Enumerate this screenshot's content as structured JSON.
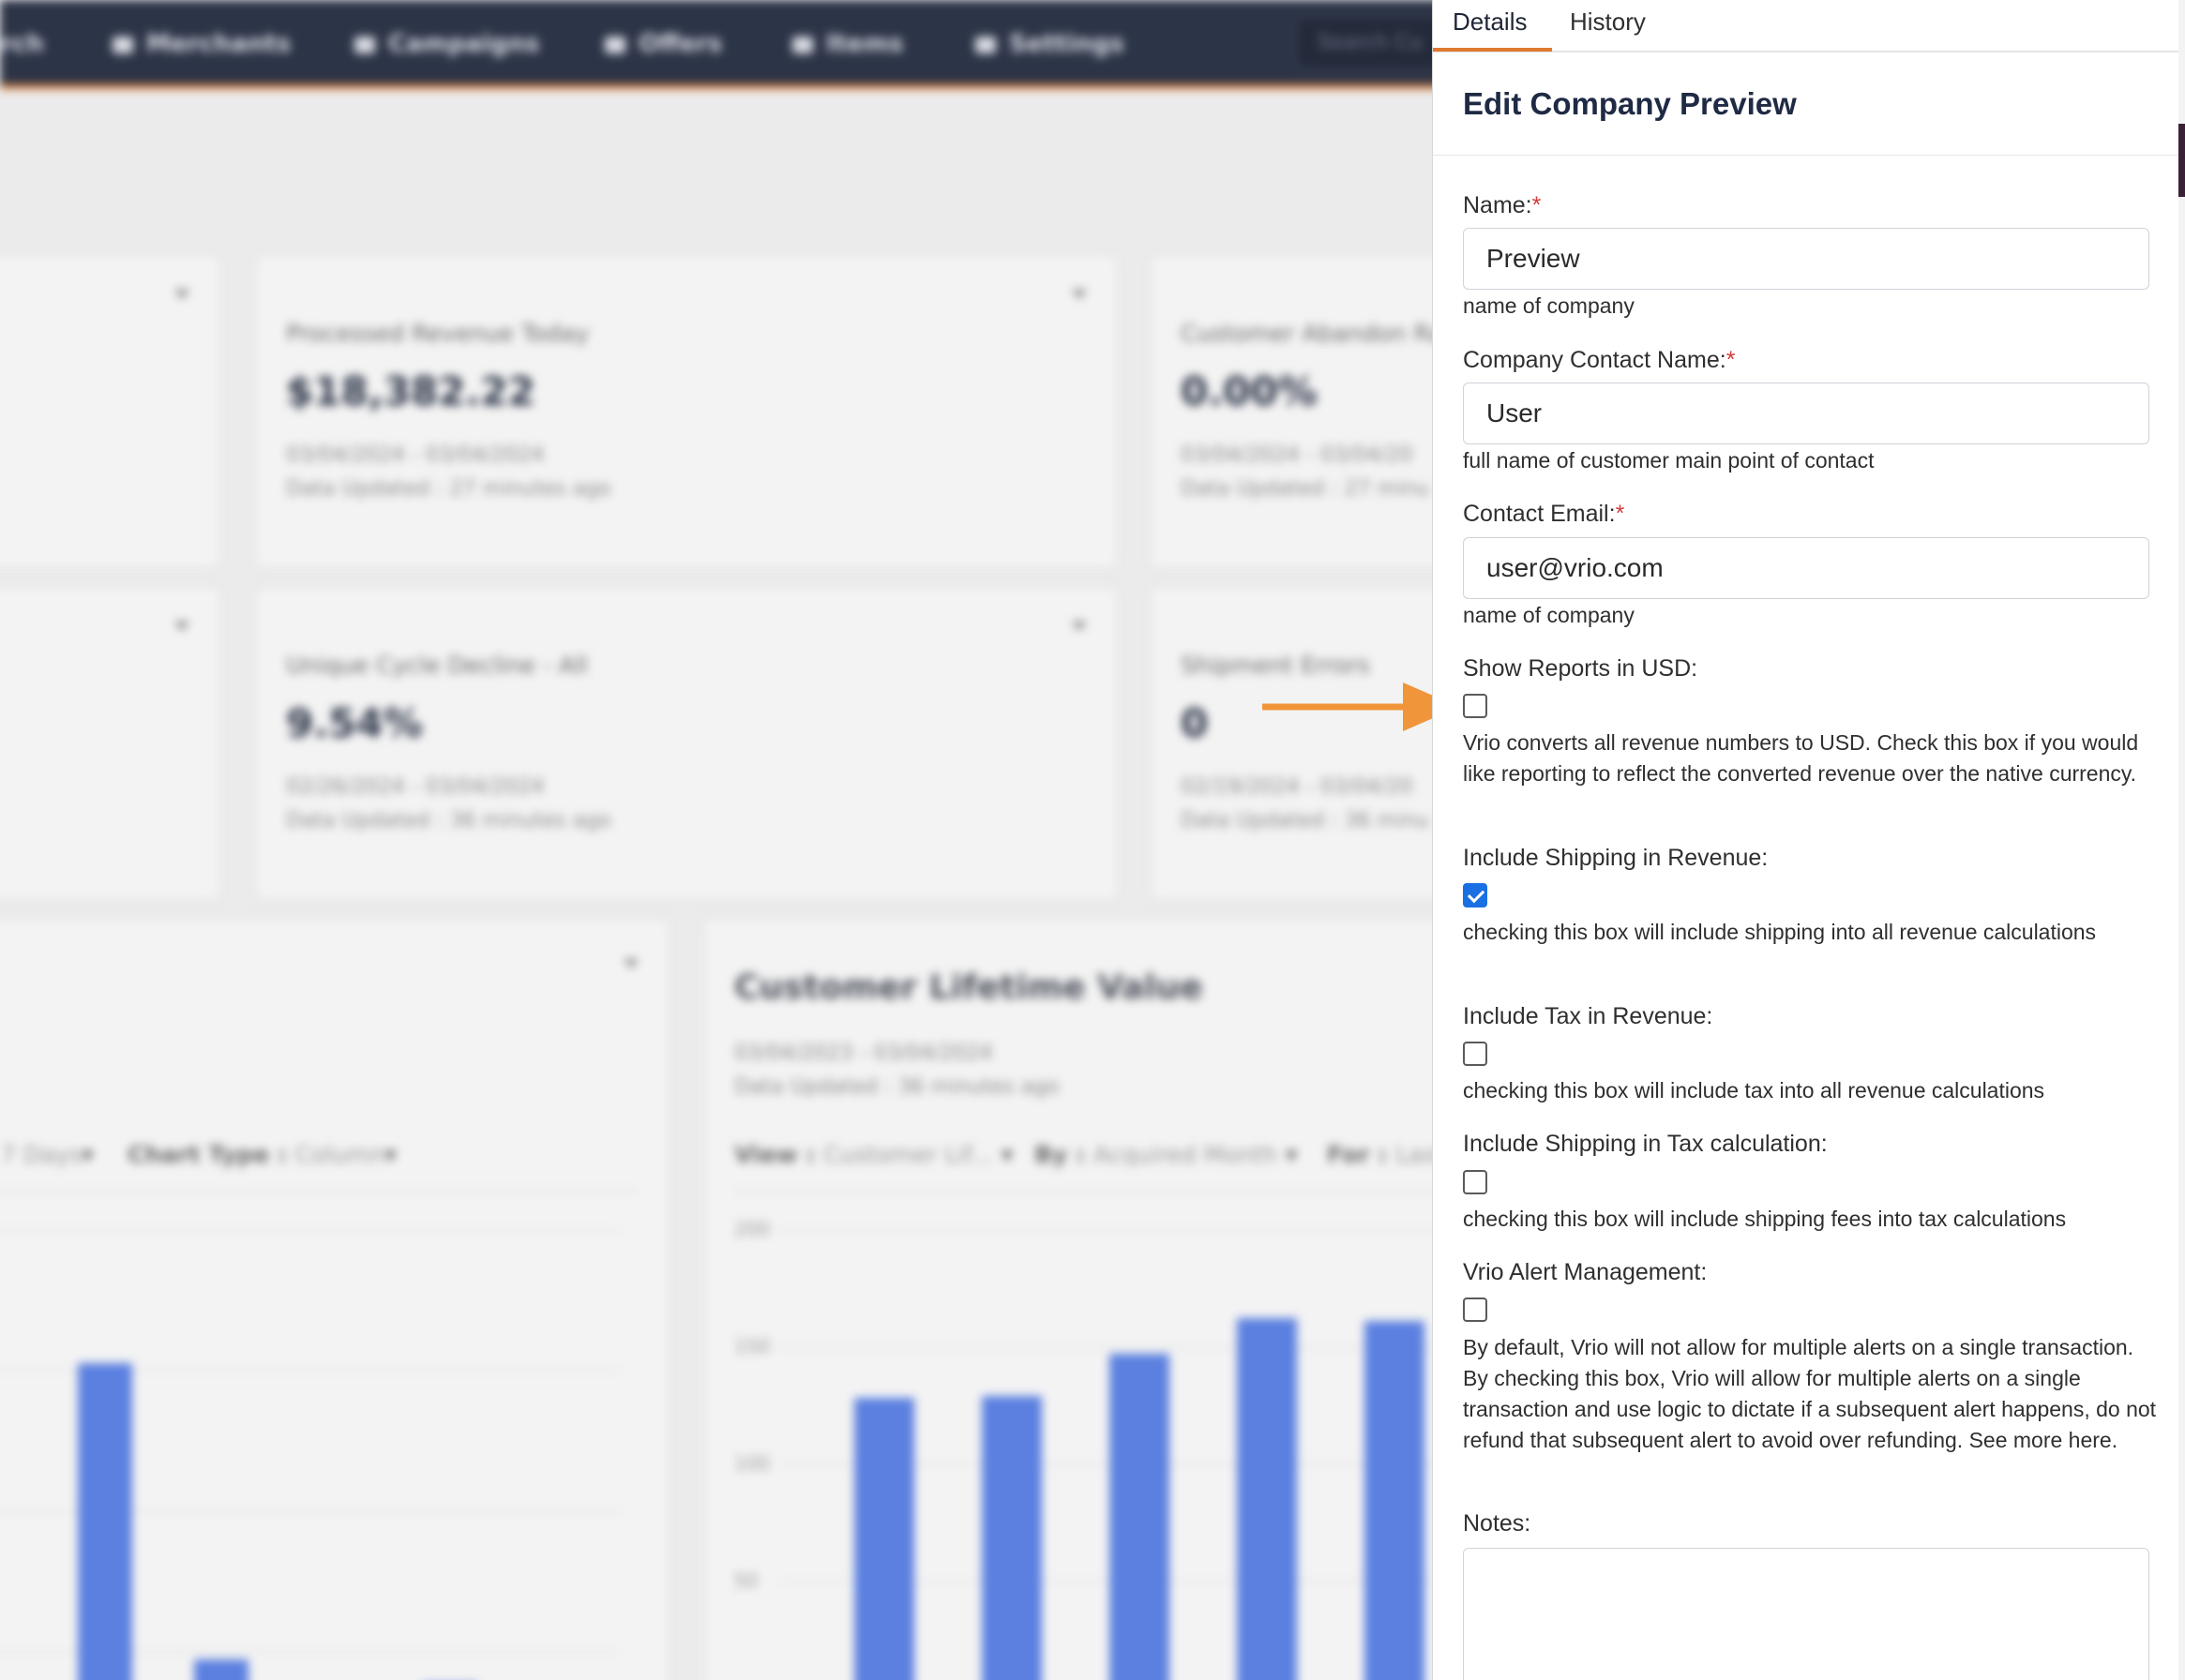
{
  "nav": {
    "items": [
      {
        "label": "rch",
        "icon": "search-icon"
      },
      {
        "label": "Merchants",
        "icon": "store-icon"
      },
      {
        "label": "Campaigns",
        "icon": "megaphone-icon"
      },
      {
        "label": "Offers",
        "icon": "tag-icon"
      },
      {
        "label": "Items",
        "icon": "box-icon"
      },
      {
        "label": "Settings",
        "icon": "settings-icon"
      }
    ],
    "search_placeholder": "Search Cu"
  },
  "dashboard": {
    "cards": [
      {
        "label": "Processed Revenue Today",
        "value": "$18,382.22",
        "date_range": "03/04/2024 - 03/04/2024",
        "updated": "Data Updated : 27 minutes ago"
      },
      {
        "label": "Customer Abandon Ra",
        "value": "0.00%",
        "date_range": "03/04/2024 - 03/04/20",
        "updated": "Data Updated : 27 minu"
      },
      {
        "label": "Unique Cycle Decline - All",
        "value": "9.54%",
        "date_range": "02/26/2024 - 03/04/2024",
        "updated": "Data Updated : 36 minutes ago"
      },
      {
        "label": "Shipment Errors",
        "value": "0",
        "date_range": "02/19/2024 - 03/04/20",
        "updated": "Data Updated : 36 minu"
      }
    ],
    "left_chart": {
      "filters": [
        {
          "key": "",
          "value": "7 Days"
        },
        {
          "key": "Chart Type",
          "value": "Column"
        }
      ]
    },
    "right_chart": {
      "title": "Customer Lifetime Value",
      "date_range": "03/04/2023 - 03/04/2024",
      "updated": "Data Updated : 36 minutes ago",
      "filters": [
        {
          "key": "View",
          "value": "Customer Lif..."
        },
        {
          "key": "By",
          "value": "Acquired Month"
        },
        {
          "key": "For",
          "value": "Last"
        }
      ]
    }
  },
  "chart_data": [
    {
      "type": "bar",
      "title": "Customer Lifetime Value",
      "ylim": [
        0,
        200
      ],
      "yticks": [
        "200",
        "150",
        "100",
        "50"
      ],
      "values": [
        128,
        129,
        147,
        162,
        161
      ],
      "grid": true,
      "legend": "none"
    },
    {
      "type": "bar",
      "title": "",
      "values_fraction_of_axis": [
        0.01,
        0.72,
        0.1,
        0.05
      ],
      "grid": true,
      "legend": "none"
    }
  ],
  "panel": {
    "tabs": [
      "Details",
      "History"
    ],
    "active_tab": "Details",
    "title": "Edit Company Preview",
    "name": {
      "label": "Name:",
      "value": "Preview",
      "help": "name of company"
    },
    "contact_name": {
      "label": "Company Contact Name:",
      "value": "User",
      "help": "full name of customer main point of contact"
    },
    "contact_email": {
      "label": "Contact Email:",
      "value": "user@vrio.com",
      "help": "name of company"
    },
    "required_mark": "*",
    "show_usd": {
      "label": "Show Reports in USD:",
      "checked": false,
      "help": "Vrio converts all revenue numbers to USD. Check this box if you would like reporting to reflect the converted revenue over the native currency."
    },
    "include_shipping": {
      "label": "Include Shipping in Revenue:",
      "checked": true,
      "help": "checking this box will include shipping into all revenue calculations"
    },
    "include_tax": {
      "label": "Include Tax in Revenue:",
      "checked": false,
      "help": "checking this box will include tax into all revenue calculations"
    },
    "shipping_in_tax": {
      "label": "Include Shipping in Tax calculation:",
      "checked": false,
      "help": "checking this box will include shipping fees into tax calculations"
    },
    "alert_mgmt": {
      "label": "Vrio Alert Management:",
      "checked": false,
      "help": "By default, Vrio will not allow for multiple alerts on a single transaction. By checking this box, Vrio will allow for multiple alerts on a single transaction and use logic to dictate if a subsequent alert happens, do not refund that subsequent alert to avoid over refunding. See more here."
    },
    "notes": {
      "label": "Notes:",
      "value": ""
    }
  },
  "colors": {
    "accent_orange": "#e07a2f",
    "nav_bg": "#2c3447",
    "checkbox_checked": "#1a6fe3",
    "bar_blue": "#5b80e0",
    "required_red": "#d63b3b"
  },
  "annotation": {
    "arrow_icon": "arrow-right-icon",
    "arrow_color": "#f0953a"
  }
}
